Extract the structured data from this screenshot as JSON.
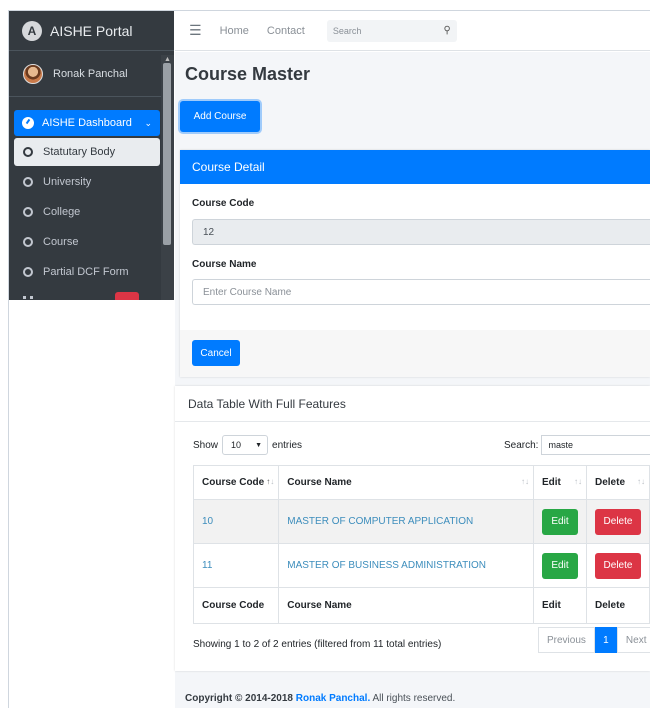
{
  "sidebar": {
    "brand": "AISHE Portal",
    "brand_logo": "A",
    "user": "Ronak Panchal",
    "dashboard": "AISHE Dashboard",
    "items": [
      {
        "label": "Statutary Body"
      },
      {
        "label": "University"
      },
      {
        "label": "College"
      },
      {
        "label": "Course"
      },
      {
        "label": "Partial DCF Form"
      }
    ]
  },
  "topnav": {
    "home": "Home",
    "contact": "Contact",
    "search_placeholder": "Search"
  },
  "page": {
    "title": "Course Master",
    "add_button": "Add Course"
  },
  "detail_card": {
    "header": "Course Detail",
    "code_label": "Course Code",
    "code_value": "12",
    "name_label": "Course Name",
    "name_placeholder": "Enter Course Name",
    "cancel_button": "Cancel"
  },
  "table_card": {
    "title": "Data Table With Full Features",
    "show_label": "Show",
    "length_value": "10",
    "entries_label": "entries",
    "search_label": "Search:",
    "search_value": "maste",
    "columns": [
      "Course Code",
      "Course Name",
      "Edit",
      "Delete"
    ],
    "rows": [
      {
        "code": "10",
        "name": "MASTER OF COMPUTER APPLICATION",
        "edit": "Edit",
        "delete": "Delete"
      },
      {
        "code": "11",
        "name": "MASTER OF BUSINESS ADMINISTRATION",
        "edit": "Edit",
        "delete": "Delete"
      }
    ],
    "footer_columns": [
      "Course Code",
      "Course Name",
      "Edit",
      "Delete"
    ],
    "info": "Showing 1 to 2 of 2 entries (filtered from 11 total entries)",
    "pagination": {
      "previous": "Previous",
      "current": "1",
      "next": "Next"
    }
  },
  "footer": {
    "copyright_prefix": "Copyright © 2014-2018",
    "copyright_owner": "Ronak Panchal.",
    "copyright_suffix": "All rights reserved."
  }
}
